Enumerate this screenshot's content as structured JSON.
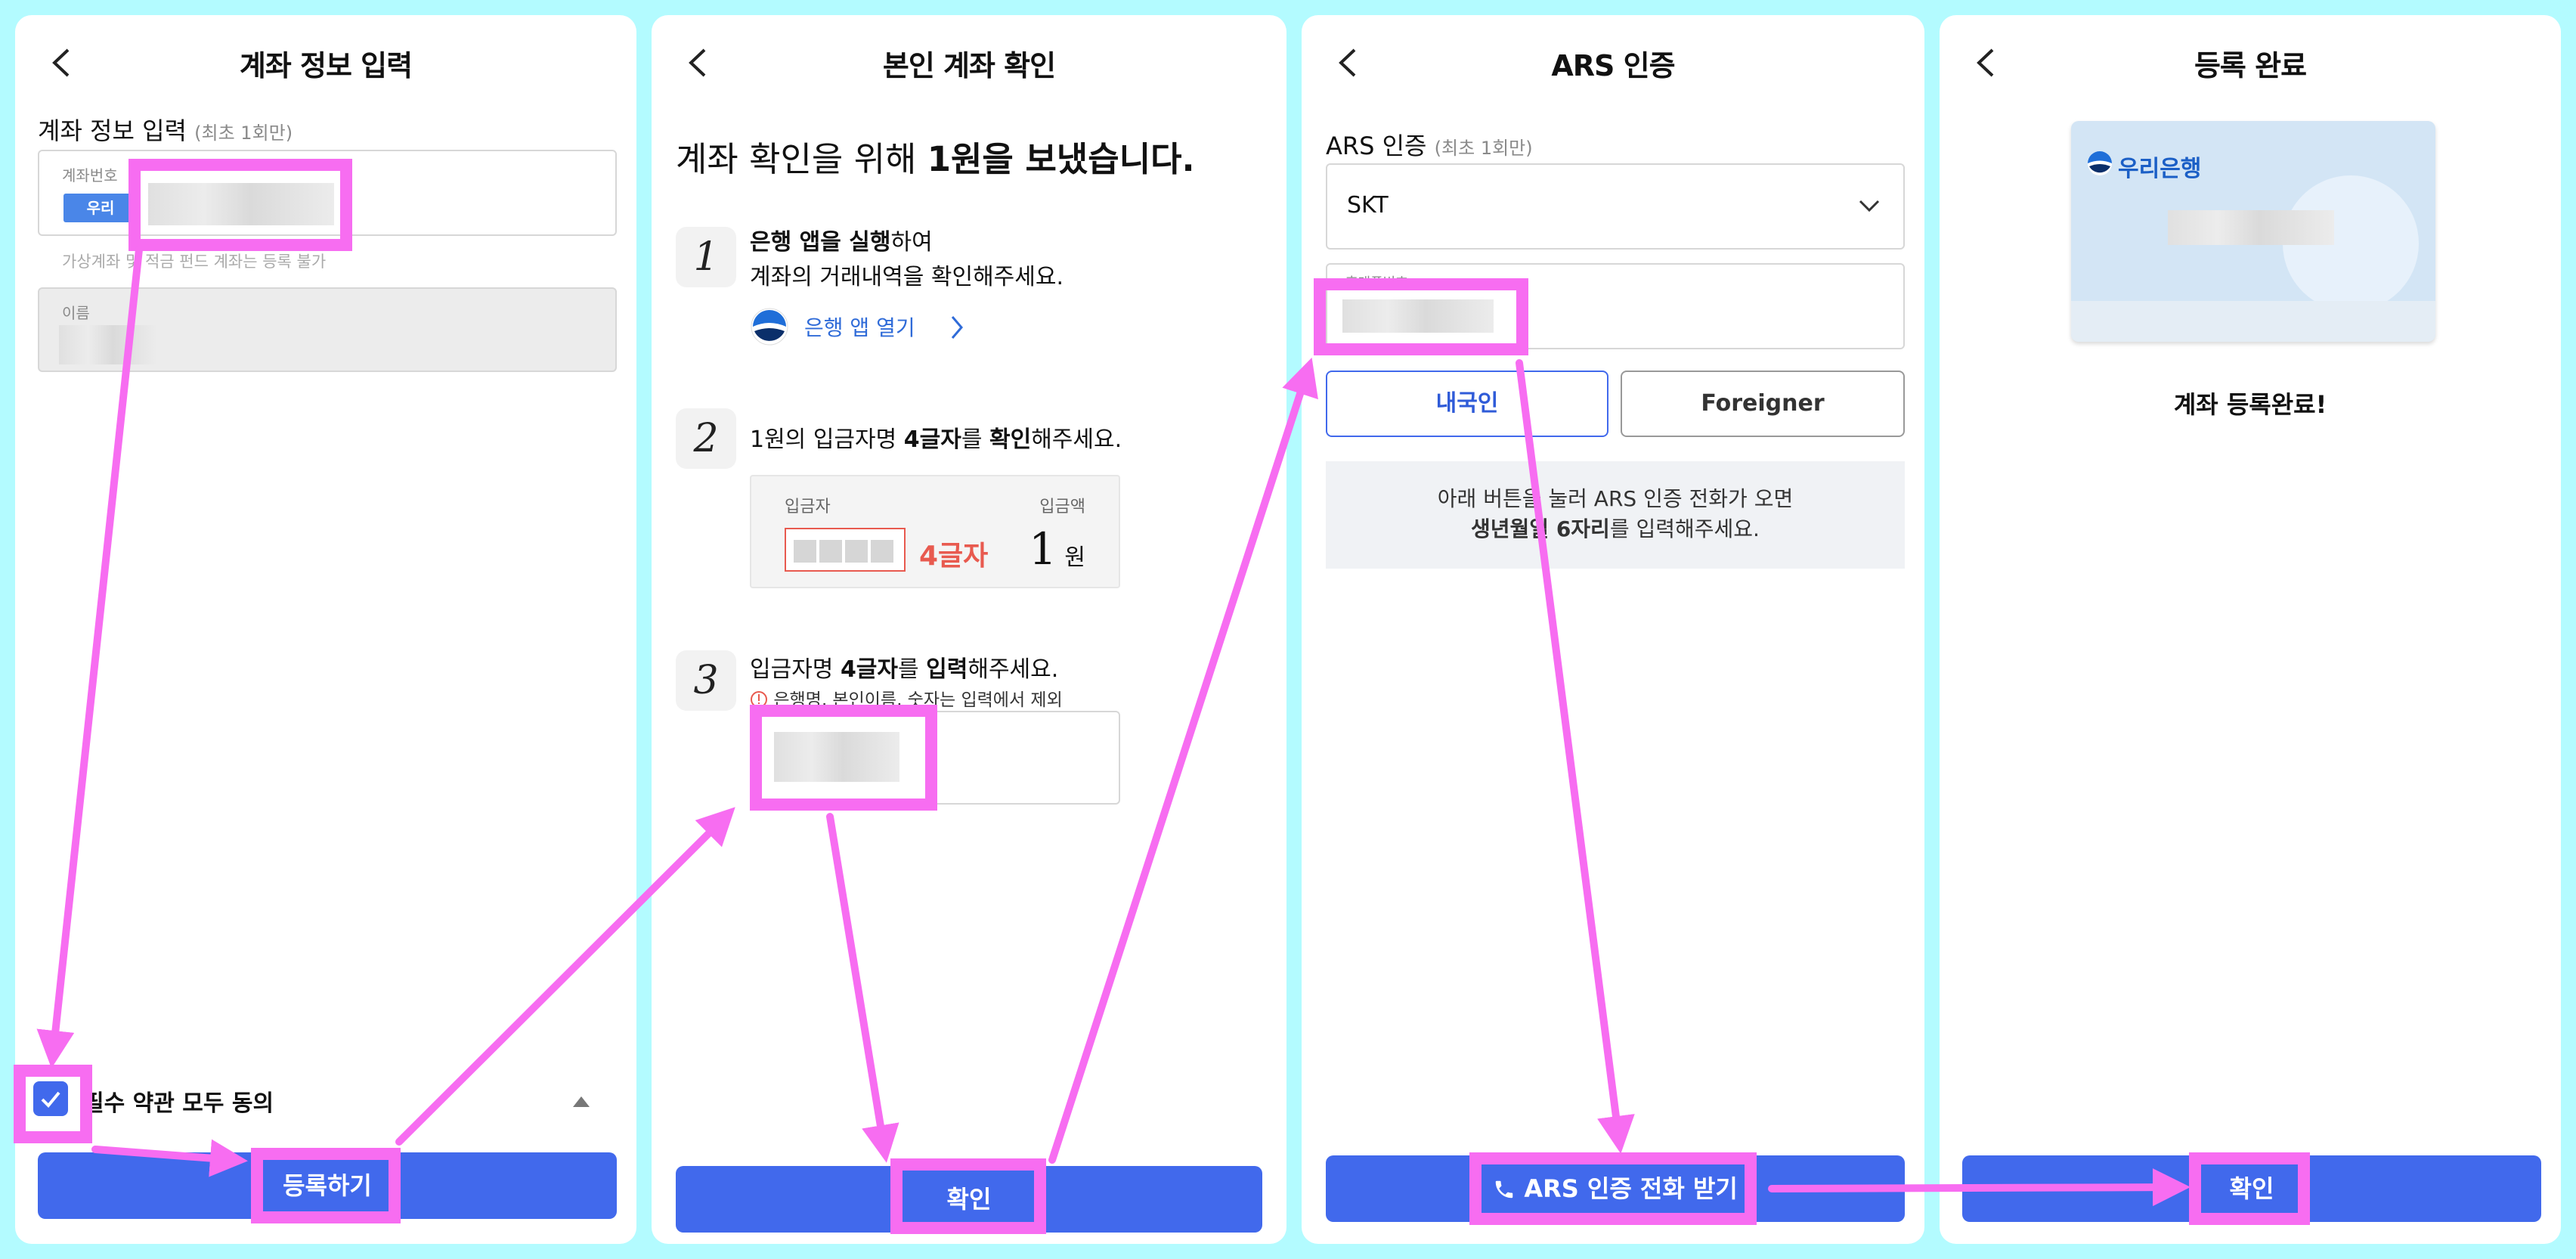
{
  "panel1": {
    "title": "계좌 정보 입력",
    "section_label": "계좌 정보 입력",
    "section_hint": "(최초 1회만)",
    "account_field_label": "계좌번호",
    "bank_chip": "우리",
    "account_note": "가상계좌 및 적금 펀드 계좌는 등록 불가",
    "name_field_label": "이름",
    "agree_label": "필수 약관 모두 동의",
    "submit_label": "등록하기"
  },
  "panel2": {
    "title": "본인 계좌 확인",
    "headline_prefix": "계좌 확인을 위해 ",
    "headline_bold": "1원을 보냈습니다.",
    "step1_num": "1",
    "step1_bold": "은행 앱을 실행",
    "step1_rest": "하여",
    "step1_line2": "계좌의 거래내역을 확인해주세요.",
    "open_app_link": "은행 앱 열기",
    "step2_num": "2",
    "step2_a": "1원의 입금자명 ",
    "step2_b": "4글자",
    "step2_c": "를 ",
    "step2_d": "확인",
    "step2_e": "해주세요.",
    "depositor_label": "입금자",
    "amount_label": "입금액",
    "four_chars": "4글자",
    "amount_value": "1",
    "amount_unit": "원",
    "step3_num": "3",
    "step3_a": "입금자명 ",
    "step3_b": "4글자",
    "step3_c": "를 ",
    "step3_d": "입력",
    "step3_e": "해주세요.",
    "step3_warning": "은행명, 본인이름, 숫자는 입력에서 제외",
    "confirm_label": "확인"
  },
  "panel3": {
    "title": "ARS 인증",
    "section_label": "ARS 인증",
    "section_hint": "(최초 1회만)",
    "carrier_value": "SKT",
    "phone_field_label": "휴대폰번호",
    "domestic_label": "내국인",
    "foreigner_label": "Foreigner",
    "info_line1": "아래 버튼을 눌러 ARS 인증 전화가 오면",
    "info_line2_bold": "생년월일 6자리",
    "info_line2_rest": "를 입력해주세요.",
    "call_label": "ARS 인증 전화 받기"
  },
  "panel4": {
    "title": "등록 완료",
    "bank_name": "우리은행",
    "done_message": "계좌 등록완료!",
    "confirm_label": "확인"
  },
  "colors": {
    "accent_blue": "#4169ec",
    "highlight_pink": "#f76df1",
    "warning_red": "#e85a4f",
    "background_cyan": "#b3fbff"
  }
}
